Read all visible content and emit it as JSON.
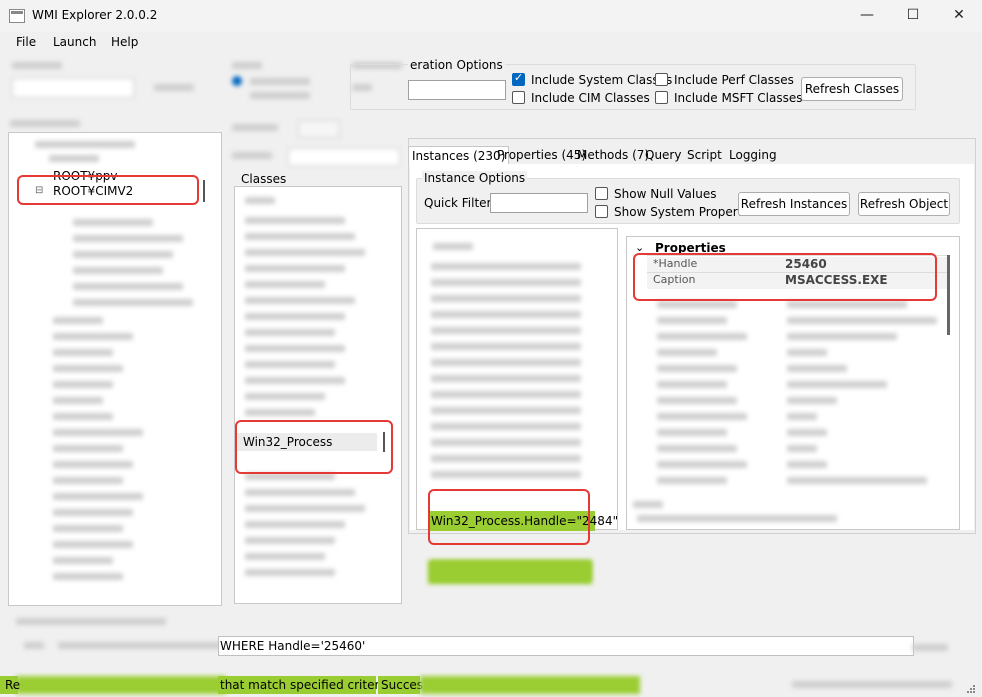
{
  "window": {
    "title": "WMI Explorer 2.0.0.2",
    "min": "—",
    "max": "☐",
    "close": "✕"
  },
  "menu": {
    "file": "File",
    "launch": "Launch",
    "help": "Help"
  },
  "enumeration": {
    "partial_label": "eration Options"
  },
  "class_options": {
    "include_system": "Include System Classes",
    "include_cim": "Include CIM Classes",
    "include_perf": "Include Perf Classes",
    "include_msft": "Include MSFT Classes",
    "include_system_checked": true,
    "refresh_classes": "Refresh Classes"
  },
  "namespaces": {
    "partial_item": "ROOT¥ppv",
    "selected_item": "ROOT¥CIMV2",
    "expander": "⊟"
  },
  "classes": {
    "header": "Classes",
    "selected": "Win32_Process"
  },
  "tabs": {
    "instances": "Instances (230)",
    "properties": "Properties (45)",
    "methods": "Methods (7)",
    "query": "Query",
    "script": "Script",
    "logging": "Logging"
  },
  "instance_options": {
    "title": "Instance Options",
    "quick_filter": "Quick Filter:",
    "show_null": "Show Null Values",
    "show_system": "Show System Properties",
    "refresh_instances": "Refresh Instances",
    "refresh_object": "Refresh Object"
  },
  "instances": {
    "selected": "Win32_Process.Handle=\"2484\""
  },
  "properties": {
    "header": "Properties",
    "collapse": "⌄",
    "rows": [
      {
        "name": "*Handle",
        "value": "25460"
      },
      {
        "name": "Caption",
        "value": "MSACCESS.EXE"
      }
    ]
  },
  "query": {
    "partial": "WHERE Handle='25460'"
  },
  "status": {
    "part1": "Re",
    "part2": "that match specified criteria.",
    "part3": "Succes"
  }
}
